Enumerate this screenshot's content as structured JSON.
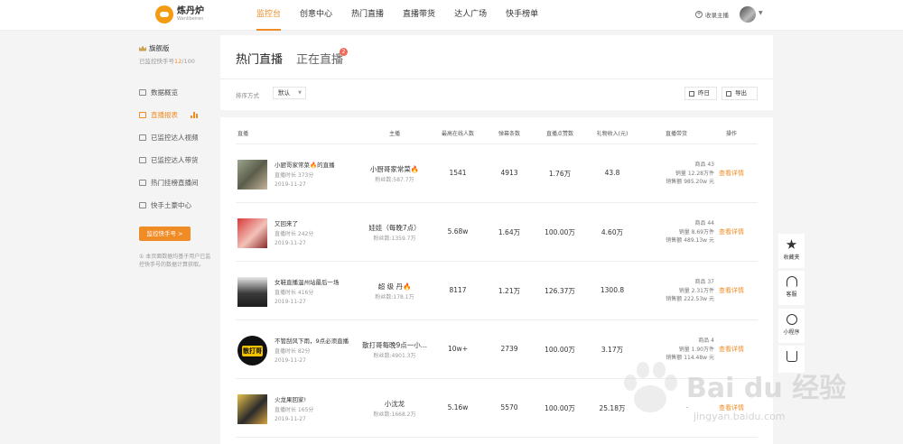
{
  "brand": {
    "name": "炼丹炉",
    "sub": "Wanlibeiren"
  },
  "nav": [
    {
      "label": "监控台",
      "active": true
    },
    {
      "label": "创意中心",
      "active": false
    },
    {
      "label": "热门直播",
      "active": false
    },
    {
      "label": "直播带货",
      "active": false
    },
    {
      "label": "达人广场",
      "active": false
    },
    {
      "label": "快手榜单",
      "active": false
    }
  ],
  "header": {
    "favorite_label": "收录主播"
  },
  "sidebar": {
    "plan_title": "旗舰版",
    "plan_prefix": "已监控快手号",
    "plan_used": "12",
    "plan_total": "/100",
    "items": [
      {
        "label": "数据概览",
        "active": false
      },
      {
        "label": "直播报表",
        "active": true
      },
      {
        "label": "已监控达人视频",
        "active": false
      },
      {
        "label": "已监控达人带货",
        "active": false
      },
      {
        "label": "热门挂榜直播间",
        "active": false
      },
      {
        "label": "快手土豪中心",
        "active": false
      }
    ],
    "monitor_button": "监控快手号 >",
    "note": "① 本页面数据均基于用户已监控快手号的数据计算获取。"
  },
  "tabs": {
    "hot": "热门直播",
    "live": "正在直播",
    "live_badge": "2"
  },
  "toolbar": {
    "sort_label": "排序方式",
    "sort_value": "默认",
    "date_button": "昨日",
    "export_button": "导出"
  },
  "columns": [
    "直播",
    "主播",
    "最高在线人数",
    "弹幕条数",
    "直播点赞数",
    "礼物收入(元)",
    "直播带货",
    "操作"
  ],
  "rows": [
    {
      "title": "小厨哥家常菜🔥的直播",
      "duration": "直播时长 373分",
      "date": "2019-11-27",
      "anchor": "小厨哥家常菜🔥",
      "fans": "粉丝数:587.7万",
      "peak": "1541",
      "danmu": "4913",
      "likes": "1.76万",
      "gift": "43.8",
      "goods": [
        "商品 43",
        "销量 12.28万件",
        "销售额 985.20w 元"
      ],
      "action": "查看详情"
    },
    {
      "title": "又回来了",
      "duration": "直播时长 242分",
      "date": "2019-11-27",
      "anchor": "娃娃（每晚7点）",
      "fans": "粉丝数:1359.7万",
      "peak": "5.68w",
      "danmu": "1.64万",
      "likes": "100.00万",
      "gift": "4.60万",
      "goods": [
        "商品 44",
        "销量 8.69万件",
        "销售额 489.13w 元"
      ],
      "action": "查看详情"
    },
    {
      "title": "女鞋直播温州站最后一场",
      "duration": "直播时长 416分",
      "date": "2019-11-27",
      "anchor": "超 级 丹🔥",
      "fans": "粉丝数:178.1万",
      "peak": "8117",
      "danmu": "1.21万",
      "likes": "126.37万",
      "gift": "1300.8",
      "goods": [
        "商品 37",
        "销量 2.31万件",
        "销售额 222.53w 元"
      ],
      "action": "查看详情"
    },
    {
      "title": "不管刮风下雨，9点必须直播",
      "duration": "直播时长 82分",
      "date": "2019-11-27",
      "anchor": "散打哥每晚9点一小...",
      "fans": "粉丝数:4901.3万",
      "peak": "10w+",
      "danmu": "2739",
      "likes": "100.00万",
      "gift": "3.17万",
      "goods": [
        "商品 4",
        "销量 1.90万件",
        "销售额 114.48w 元"
      ],
      "action": "查看详情"
    },
    {
      "title": "火龙果回家!",
      "duration": "直播时长 165分",
      "date": "2019-11-27",
      "anchor": "小沈龙",
      "fans": "粉丝数:1668.2万",
      "peak": "5.16w",
      "danmu": "5570",
      "likes": "100.00万",
      "gift": "25.18万",
      "goods": [
        "-"
      ],
      "action": "查看详情"
    }
  ],
  "thumb_badge": "散打哥",
  "float_bar": [
    {
      "icon": "star-icon",
      "label": "收藏夹"
    },
    {
      "icon": "headset-icon",
      "label": "客服"
    },
    {
      "icon": "miniapp-icon",
      "label": "小程序"
    },
    {
      "icon": "cart-icon",
      "label": ""
    }
  ],
  "watermark": {
    "text": "Bai du 经验",
    "url": "jingyan.baidu.com"
  },
  "colors": {
    "accent": "#f08c26",
    "badge": "#f06a5a"
  }
}
